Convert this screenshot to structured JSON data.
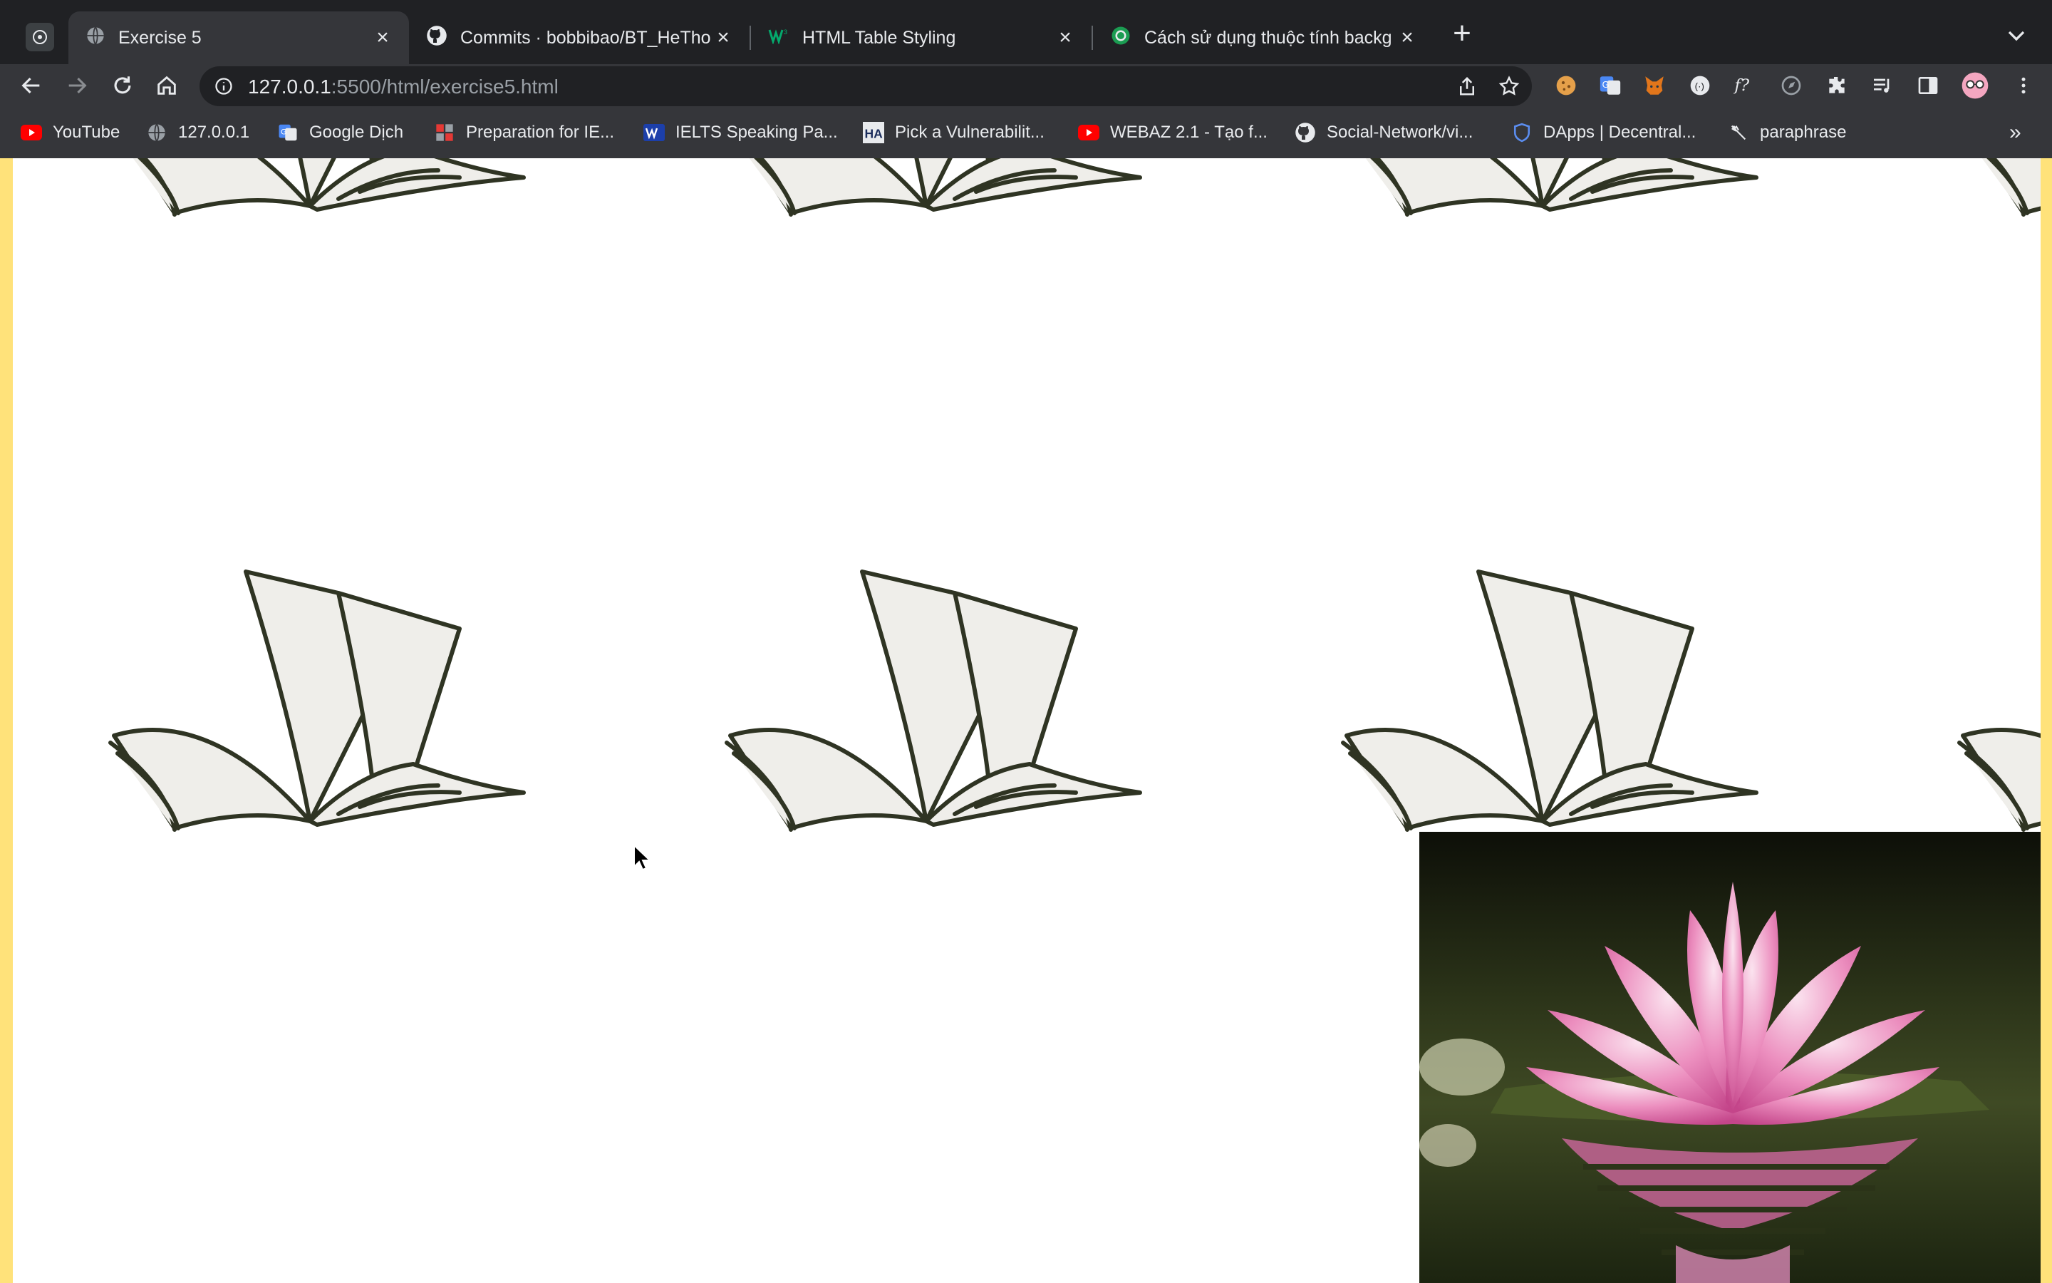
{
  "browser": {
    "tabs": [
      {
        "title": "Exercise 5",
        "icon": "globe-icon",
        "active": true
      },
      {
        "title": "Commits · bobbibao/BT_HeTho",
        "icon": "github-icon",
        "active": false
      },
      {
        "title": "HTML Table Styling",
        "icon": "w3-icon",
        "active": false
      },
      {
        "title": "Cách sử dụng thuộc tính backg",
        "icon": "green-logo-icon",
        "active": false
      }
    ],
    "address": {
      "host": "127.0.0.1",
      "path": ":5500/html/exercise5.html"
    },
    "bookmarks": [
      {
        "label": "YouTube",
        "icon": "youtube-icon"
      },
      {
        "label": "127.0.0.1",
        "icon": "globe-icon"
      },
      {
        "label": "Google Dịch",
        "icon": "translate-icon"
      },
      {
        "label": "Preparation for IE...",
        "icon": "red-squares-icon"
      },
      {
        "label": "IELTS Speaking Pa...",
        "icon": "w-logo-icon"
      },
      {
        "label": "Pick a Vulnerabilit...",
        "icon": "ha-logo-icon"
      },
      {
        "label": "WEBAZ 2.1 - Tạo f...",
        "icon": "youtube-icon"
      },
      {
        "label": "Social-Network/vi...",
        "icon": "github-icon"
      },
      {
        "label": "DApps | Decentral...",
        "icon": "shield-icon"
      },
      {
        "label": "paraphrase",
        "icon": "feather-icon"
      }
    ],
    "more_bookmarks": "»"
  },
  "colors": {
    "page_border": "#ffe27a",
    "page_background": "#ffffff",
    "book_fill": "#efeeea",
    "book_stroke": "#2f3423",
    "lotus_petal": "#e27ab0"
  },
  "page": {
    "background_image": "open-book-illustration",
    "overlay_image": "pink-lotus-on-water"
  }
}
